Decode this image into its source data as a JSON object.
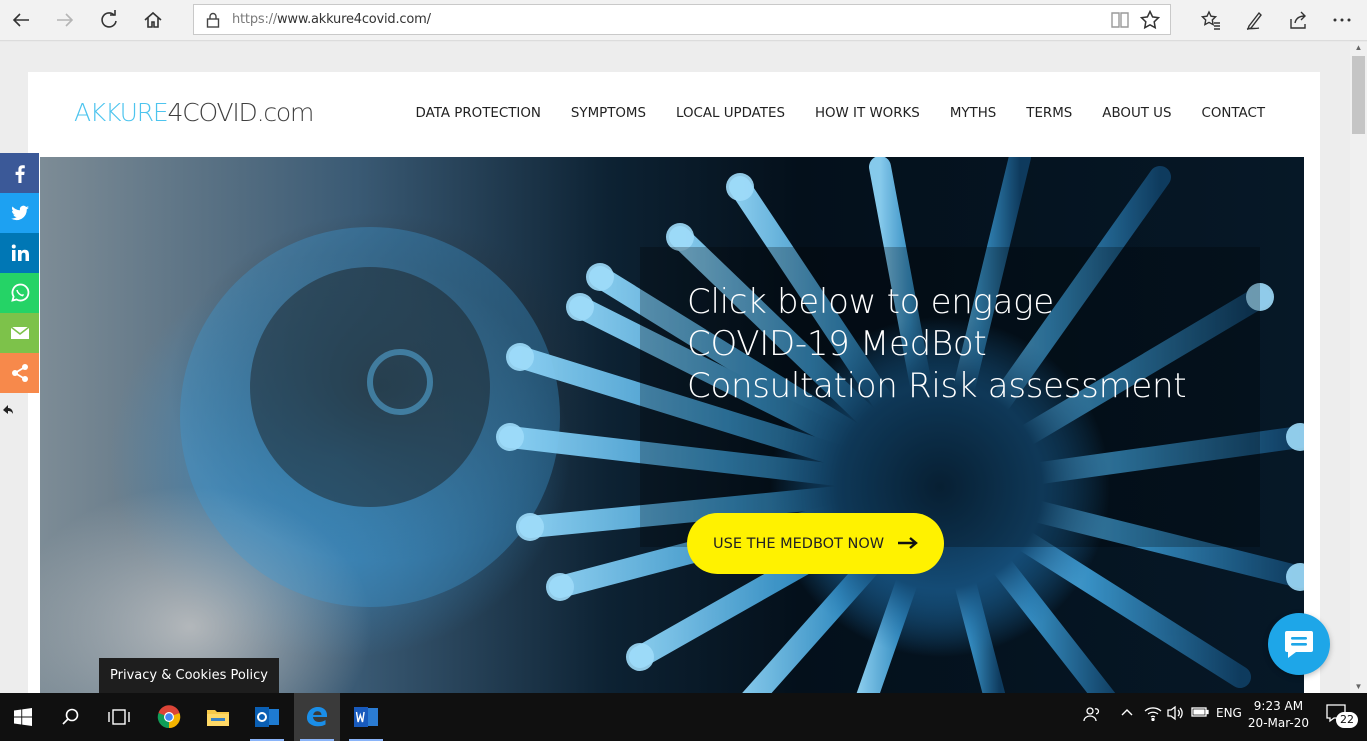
{
  "browser": {
    "url_scheme": "https://",
    "url_host": "www.akkure4covid.com/",
    "icons": [
      "back-icon",
      "forward-icon",
      "refresh-icon",
      "home-icon",
      "lock-icon",
      "reading-view-icon",
      "favorite-star-icon",
      "favorites-hub-icon",
      "pen-icon",
      "share-icon",
      "more-icon"
    ]
  },
  "site": {
    "logo_part1": "AKKURE",
    "logo_part2": "4COVID.com",
    "nav": [
      "DATA PROTECTION",
      "SYMPTOMS",
      "LOCAL UPDATES",
      "HOW IT WORKS",
      "MYTHS",
      "TERMS",
      "ABOUT US",
      "CONTACT"
    ],
    "hero_title_line1": "Click below to engage",
    "hero_title_line2": "COVID-19 MedBot",
    "hero_title_line3": "Consultation Risk assessment",
    "cta_label": "USE THE MEDBOT NOW",
    "privacy_label": "Privacy & Cookies Policy"
  },
  "share": [
    {
      "name": "facebook",
      "color": "#3b5998",
      "glyph": "f"
    },
    {
      "name": "twitter",
      "color": "#1da1f2",
      "glyph": "t"
    },
    {
      "name": "linkedin",
      "color": "#0077b5",
      "glyph": "in"
    },
    {
      "name": "whatsapp",
      "color": "#25d366",
      "glyph": "w"
    },
    {
      "name": "email",
      "color": "#7dc24a",
      "glyph": "e"
    },
    {
      "name": "share",
      "color": "#f7894b",
      "glyph": "s"
    }
  ],
  "colors": {
    "logo_accent": "#4dc4ee",
    "cta_bg": "#fff200",
    "chat_bg": "#1ea6e8"
  },
  "taskbar": {
    "lang": "ENG",
    "time": "9:23 AM",
    "date": "20-Mar-20",
    "notif_count": "22"
  }
}
